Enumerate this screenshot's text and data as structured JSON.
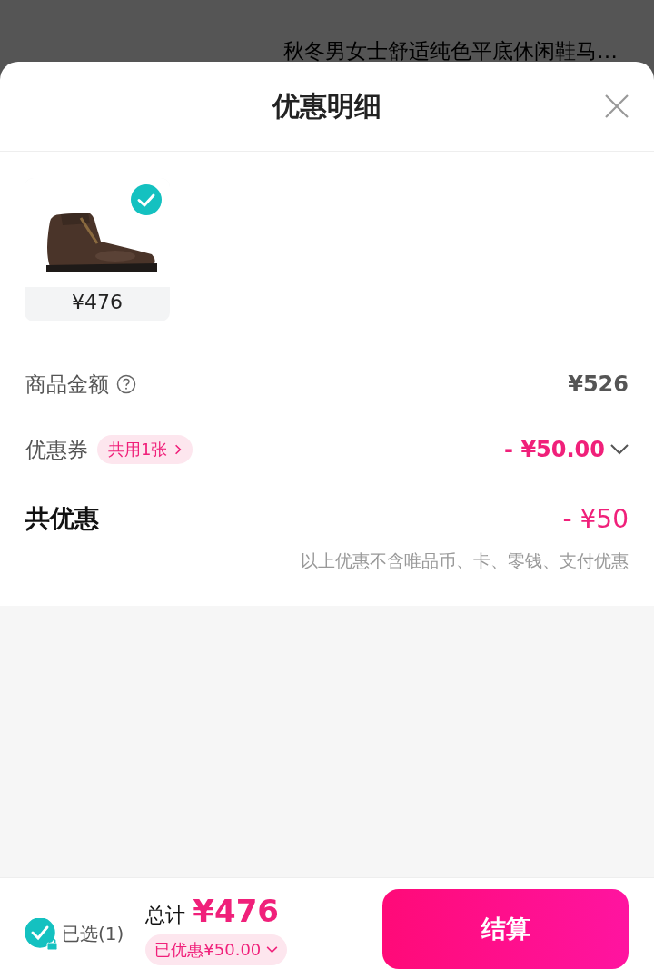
{
  "background": {
    "product_title": "秋冬男女士舒适纯色平底休闲鞋马…"
  },
  "sheet": {
    "title": "优惠明细"
  },
  "products": [
    {
      "kind": "picture",
      "price": "¥476",
      "selected": true
    }
  ],
  "rows": [
    {
      "kind": "amount",
      "label": "商品金额",
      "value": "¥526"
    },
    {
      "kind": "coupon",
      "label": "优惠券",
      "tag": "共用1张",
      "value": "- ¥50.00"
    }
  ],
  "total_discount": {
    "label": "共优惠",
    "value": "- ¥50",
    "note": "以上优惠不含唯品币、卡、零钱、支付优惠"
  },
  "footer": {
    "selected_label": "已选(1)",
    "all_selected": true,
    "total_label": "总计",
    "total": "¥476",
    "discount": "已优惠¥50.00",
    "checkout": "结算"
  }
}
